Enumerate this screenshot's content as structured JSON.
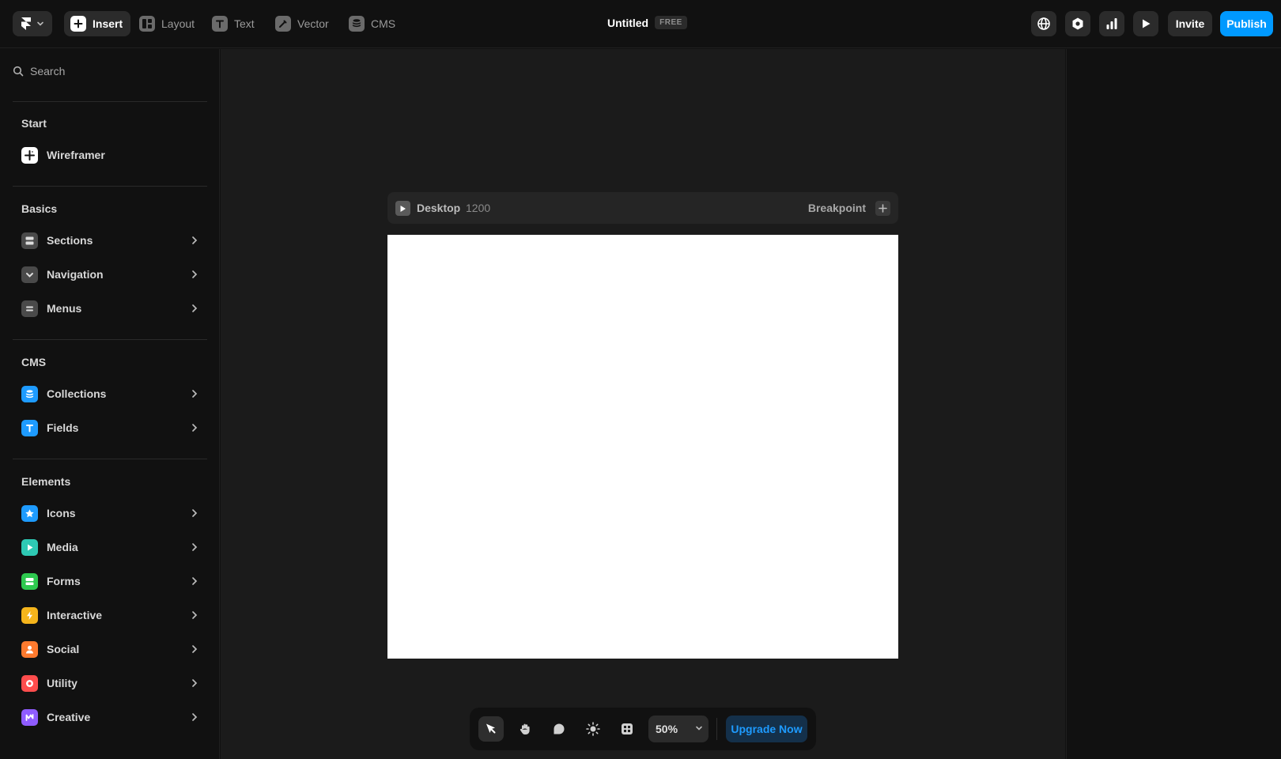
{
  "topbar": {
    "tools": [
      {
        "label": "Insert",
        "icon": "plus-icon",
        "active": true
      },
      {
        "label": "Layout",
        "icon": "layout-icon",
        "active": false
      },
      {
        "label": "Text",
        "icon": "text-icon",
        "active": false
      },
      {
        "label": "Vector",
        "icon": "pen-icon",
        "active": false
      },
      {
        "label": "CMS",
        "icon": "database-icon",
        "active": false
      }
    ],
    "doc_title": "Untitled",
    "plan_badge": "FREE",
    "right_icons": [
      "globe-icon",
      "settings-icon",
      "analytics-icon",
      "play-icon"
    ],
    "invite_label": "Invite",
    "publish_label": "Publish"
  },
  "sidebar": {
    "search_placeholder": "Search",
    "sections": [
      {
        "title": "Start",
        "items": [
          {
            "label": "Wireframer",
            "icon": "wireframer-icon",
            "color": "#ffffff"
          }
        ]
      },
      {
        "title": "Basics",
        "items": [
          {
            "label": "Sections",
            "icon": "sections-icon",
            "color": "#4a4a4a"
          },
          {
            "label": "Navigation",
            "icon": "navigation-icon",
            "color": "#4a4a4a"
          },
          {
            "label": "Menus",
            "icon": "menus-icon",
            "color": "#4a4a4a"
          }
        ]
      },
      {
        "title": "CMS",
        "items": [
          {
            "label": "Collections",
            "icon": "collections-icon",
            "color": "#1e9bff"
          },
          {
            "label": "Fields",
            "icon": "fields-icon",
            "color": "#1e9bff"
          }
        ]
      },
      {
        "title": "Elements",
        "items": [
          {
            "label": "Icons",
            "icon": "star-icon",
            "color": "#1e9bff"
          },
          {
            "label": "Media",
            "icon": "media-icon",
            "color": "#2ec9b4"
          },
          {
            "label": "Forms",
            "icon": "forms-icon",
            "color": "#2ec94f"
          },
          {
            "label": "Interactive",
            "icon": "bolt-icon",
            "color": "#f5b51c"
          },
          {
            "label": "Social",
            "icon": "social-icon",
            "color": "#ff7a2e"
          },
          {
            "label": "Utility",
            "icon": "utility-icon",
            "color": "#ff4d4d"
          },
          {
            "label": "Creative",
            "icon": "creative-icon",
            "color": "#8f5cff"
          }
        ]
      }
    ]
  },
  "canvas": {
    "breakpoint_name": "Desktop",
    "breakpoint_width": "1200",
    "breakpoint_label": "Breakpoint"
  },
  "bottom_toolbar": {
    "tools": [
      "pointer-icon",
      "hand-icon",
      "comment-icon",
      "theme-icon",
      "components-icon"
    ],
    "zoom": "50%",
    "upgrade_label": "Upgrade Now"
  },
  "colors": {
    "accent": "#0099ff",
    "background": "#111111",
    "canvas": "#1b1b1b"
  }
}
